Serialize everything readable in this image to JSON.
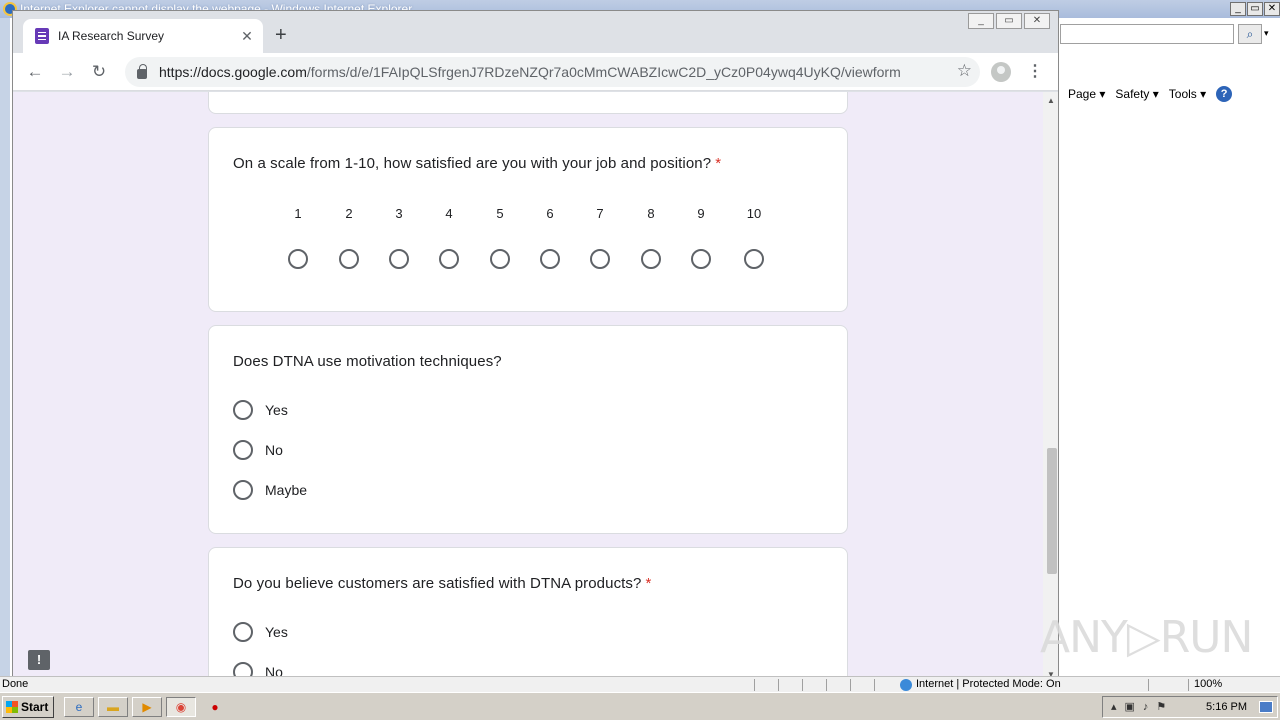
{
  "ie": {
    "title": "Internet Explorer cannot display the webpage - Windows Internet Explorer",
    "window_buttons": [
      "_",
      "▭",
      "✕"
    ],
    "command_bar": [
      "Page ▾",
      "Safety ▾",
      "Tools ▾"
    ],
    "status": "Done",
    "zone": "Internet | Protected Mode: On",
    "zoom": "100%"
  },
  "chrome": {
    "tab_title": "IA Research Survey",
    "tab_close": "✕",
    "new_tab": "+",
    "window_buttons": [
      "_",
      "▭",
      "✕"
    ],
    "url_host": "https://docs.google.com",
    "url_path": "/forms/d/e/1FAIpQLSfrgenJ7RDzeNZQr7a0cMmCWABZIcwC2D_yCz0P04ywq4UyKQ/viewform",
    "back": "←",
    "forward": "→",
    "reload": "↻",
    "star": "☆",
    "menu": "⋮"
  },
  "form": {
    "q1": {
      "title": "On a scale from 1-10, how satisfied are you with your job and position?",
      "required": "*",
      "scale": [
        "1",
        "2",
        "3",
        "4",
        "5",
        "6",
        "7",
        "8",
        "9",
        "10"
      ]
    },
    "q2": {
      "title": "Does DTNA use motivation techniques?",
      "options": [
        "Yes",
        "No",
        "Maybe"
      ]
    },
    "q3": {
      "title": "Do you believe customers are satisfied with DTNA products?",
      "required": "*",
      "options": [
        "Yes",
        "No"
      ]
    },
    "feedback": "!"
  },
  "watermark": "ANY▷RUN",
  "taskbar": {
    "start": "Start",
    "clock": "5:16 PM"
  },
  "colors": {
    "form_background": "#f0ebf8",
    "required": "#d93025",
    "forms_brand": "#673ab7"
  }
}
